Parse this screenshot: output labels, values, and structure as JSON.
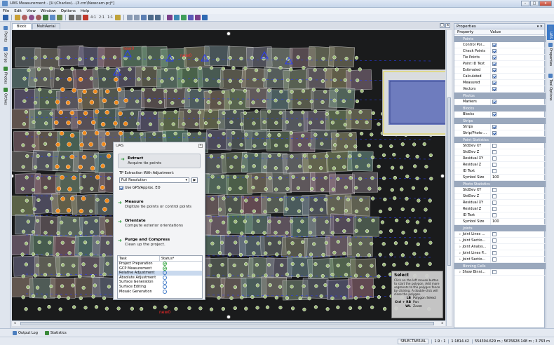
{
  "window": {
    "title": "UAS Measurement - [U:\\Charles\\...\\3.cm\\Newcam.prj*]",
    "buttons": [
      "–",
      "□",
      "x"
    ]
  },
  "menu": [
    "File",
    "Edit",
    "View",
    "Window",
    "Options",
    "Help"
  ],
  "toolbar": {
    "zoom_labels": [
      "4:1",
      "2:1",
      "1:1"
    ]
  },
  "left_tabs": [
    "Points",
    "Strips",
    "Photos",
    "Orthos"
  ],
  "doc_tabs": [
    "Block",
    "MultiAerial"
  ],
  "canvas": {
    "labels": [
      "new0",
      "new0",
      "new0"
    ]
  },
  "uas_panel": {
    "title": "UAS",
    "extract": {
      "title": "Extract",
      "sub": "Acquire tie points"
    },
    "tp_label": "TP Extraction With Adjustment:",
    "resolution": "Full Resolution",
    "gps_checkbox": "Use GPS/Approx. EO",
    "measure": {
      "title": "Measure",
      "sub": "Digitize tie points or control points"
    },
    "orientate": {
      "title": "Orientate",
      "sub": "Compute exterior orientations"
    },
    "purge": {
      "title": "Purge and Compress",
      "sub": "Clean up the project."
    },
    "task_header": "Task",
    "status_header": "Status*",
    "tasks": [
      {
        "name": "Project Preparation",
        "status": "done"
      },
      {
        "name": "GCP Measurement",
        "status": "done"
      },
      {
        "name": "Relative Adjustment",
        "status": "pending"
      },
      {
        "name": "Absolute Adjustment",
        "status": "pending"
      },
      {
        "name": "Surface Generation",
        "status": "pending"
      },
      {
        "name": "Surface Editing",
        "status": "pending"
      },
      {
        "name": "Mosaic Generation",
        "status": "pending"
      }
    ]
  },
  "tooltip": {
    "title": "Select",
    "desc": "Click on the left mouse button to start the polygon. Add more segments to the polygon fence by clicking. A double-click will close the polygon.",
    "keys": [
      {
        "key": "LB",
        "action": "Polygon Select"
      },
      {
        "key": "Ctrl + RB",
        "action": "Pan"
      },
      {
        "key": "WL",
        "action": "Zoom"
      }
    ]
  },
  "properties": {
    "title": "Properties",
    "col_property": "Property",
    "col_value": "Value",
    "rows": [
      {
        "type": "sec",
        "label": "Points"
      },
      {
        "label": "Control Poi...",
        "checked": true
      },
      {
        "label": "Check Points",
        "checked": true
      },
      {
        "label": "Tie Points",
        "checked": true
      },
      {
        "label": "Point ID Text",
        "checked": true
      },
      {
        "label": "Estimated",
        "checked": true
      },
      {
        "label": "Calculated",
        "checked": true
      },
      {
        "label": "Measured",
        "checked": true
      },
      {
        "label": "Vectors",
        "checked": true
      },
      {
        "type": "sec",
        "label": "Photos"
      },
      {
        "label": "Markers",
        "checked": true
      },
      {
        "type": "sec",
        "label": "Blocks"
      },
      {
        "label": "Blocks",
        "checked": true
      },
      {
        "type": "sec",
        "label": "Strips"
      },
      {
        "label": "Strips",
        "checked": true
      },
      {
        "label": "Strip/Photo ...",
        "checked": true
      },
      {
        "type": "sec",
        "label": "Point Statistics"
      },
      {
        "label": "StdDev XY",
        "checked": false
      },
      {
        "label": "StdDev Z",
        "checked": false
      },
      {
        "label": "Residual XY",
        "checked": false
      },
      {
        "label": "Residual Z",
        "checked": false
      },
      {
        "label": "ID Text",
        "checked": false
      },
      {
        "label": "Symbol Size",
        "value": "100"
      },
      {
        "type": "sec",
        "label": "Photo Statistics"
      },
      {
        "label": "StdDev XY",
        "checked": false
      },
      {
        "label": "StdDev Z",
        "checked": false
      },
      {
        "label": "Residual XY",
        "checked": false
      },
      {
        "label": "Residual Z",
        "checked": false
      },
      {
        "label": "ID Text",
        "checked": false
      },
      {
        "label": "Symbol Size",
        "value": "100"
      },
      {
        "type": "sec",
        "label": "Joints"
      },
      {
        "type": "exp",
        "label": "Joint Lines ...",
        "checked": false
      },
      {
        "type": "exp",
        "label": "Joint Sectio...",
        "checked": false
      },
      {
        "type": "exp",
        "label": "Joint Analys...",
        "checked": false
      },
      {
        "type": "exp",
        "label": "Joint Lines P...",
        "checked": false
      },
      {
        "type": "exp",
        "label": "Joint Sectio...",
        "checked": false
      },
      {
        "type": "sec",
        "label": "Binning Cells"
      },
      {
        "type": "exp",
        "label": "Show Binni...",
        "checked": false
      }
    ]
  },
  "right_tabs": [
    "UAS",
    "Properties",
    "Tool Options"
  ],
  "bottom_tabs": [
    "Output Log",
    "Statistics"
  ],
  "status": {
    "mode": "SELECTAERIAL",
    "ratio": "1.9 : 1",
    "scale": "1:1814.42",
    "coords": "554304.629 m ; 5676628.148 m ; 3.763 m"
  },
  "colors": {
    "tie_point_orange": "#f08a1c",
    "tie_point_green": "#9fbc7a",
    "vector_blue": "#2a3cff",
    "label_red": "#ff2a2a",
    "section_header": "#9aa8bd",
    "highlight": "#c9d9ee"
  }
}
